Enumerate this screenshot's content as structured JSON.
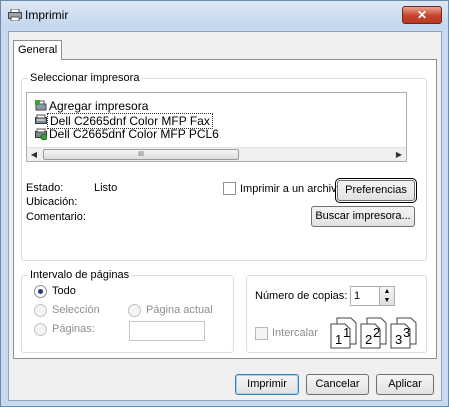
{
  "window": {
    "title": "Imprimir",
    "close_label": "✕"
  },
  "tabs": [
    {
      "label": "General"
    }
  ],
  "select_printer": {
    "legend": "Seleccionar impresora",
    "items": [
      {
        "label": "Agregar impresora",
        "icon": "add-printer-icon"
      },
      {
        "label": "Dell C2665dnf Color MFP Fax",
        "icon": "fax-printer-icon",
        "selected": true
      },
      {
        "label": "Dell C2665dnf Color MFP PCL6",
        "icon": "default-printer-icon"
      }
    ],
    "scroll_thumb_label": "III",
    "status_label": "Estado:",
    "status_value": "Listo",
    "location_label": "Ubicación:",
    "comment_label": "Comentario:",
    "print_to_file_label": "Imprimir a un archivo",
    "preferences_label": "Preferencias",
    "find_printer_label": "Buscar impresora..."
  },
  "page_range": {
    "legend": "Intervalo de páginas",
    "all_label": "Todo",
    "selection_label": "Selección",
    "current_page_label": "Página actual",
    "pages_label": "Páginas:",
    "pages_value": ""
  },
  "copies": {
    "number_label": "Número de copias:",
    "number_value": "1",
    "collate_label": "Intercalar",
    "collate_numbers": [
      "1",
      "1",
      "2",
      "2",
      "3",
      "3"
    ]
  },
  "footer": {
    "print_label": "Imprimir",
    "cancel_label": "Cancelar",
    "apply_label": "Aplicar"
  }
}
